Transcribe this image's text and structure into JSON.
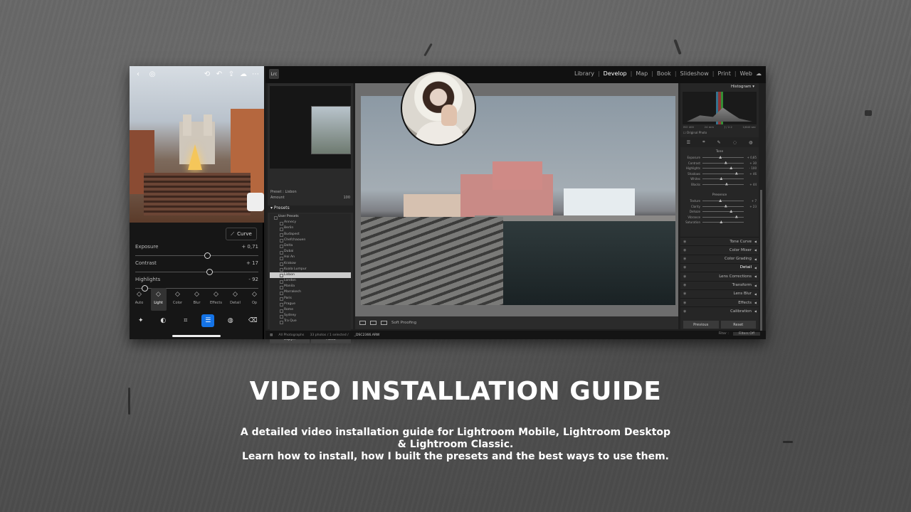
{
  "headline": {
    "title": "VIDEO INSTALLATION GUIDE",
    "line1": "A detailed video installation guide for Lightroom Mobile, Lightroom Desktop",
    "line2": "& Lightroom Classic.",
    "line3": "Learn how to install, how I built the presets and the best ways to use them."
  },
  "mobile": {
    "curve_label": "Curve",
    "sliders": [
      {
        "label": "Exposure",
        "value": "+ 0,71",
        "level": 0.56
      },
      {
        "label": "Contrast",
        "value": "+ 17",
        "level": 0.58
      },
      {
        "label": "Highlights",
        "value": "- 92",
        "level": 0.05
      }
    ],
    "tools": [
      {
        "label": "Auto",
        "icon": "auto-icon"
      },
      {
        "label": "Light",
        "icon": "sun-icon",
        "active": true
      },
      {
        "label": "Color",
        "icon": "thermometer-icon"
      },
      {
        "label": "Blur",
        "icon": "drop-icon"
      },
      {
        "label": "Effects",
        "icon": "effects-icon"
      },
      {
        "label": "Detail",
        "icon": "triangle-icon"
      },
      {
        "label": "Op",
        "icon": "optics-icon"
      }
    ],
    "accent": "#1473e6"
  },
  "classic": {
    "modules": [
      "Library",
      "Develop",
      "Map",
      "Book",
      "Slideshow",
      "Print",
      "Web"
    ],
    "active_module": "Develop",
    "preset_line": "Preset : Lisbon",
    "amount_label": "Amount",
    "amount_value": "100",
    "presets_header": "Presets",
    "preset_group": "User Presets",
    "presets": [
      "Annecy",
      "Berlin",
      "Budapest",
      "Chefchaouen",
      "Delta",
      "Dubai",
      "Hoi An",
      "Krakow",
      "Kuala Lumpur",
      "Lisbon",
      "London",
      "Manila",
      "Marrakech",
      "Paris",
      "Prague",
      "Rome",
      "Sydney",
      "Tra Que"
    ],
    "selected_preset": "Lisbon",
    "copy_label": "Copy...",
    "paste_label": "Paste",
    "soft_proofing": "Soft Proofing",
    "histogram_label": "Histogram",
    "original_photo": "Original Photo",
    "tone_title": "Tone",
    "tone_sliders": [
      {
        "label": "Exposure",
        "value": "+ 0,85"
      },
      {
        "label": "Contrast",
        "value": "+ 30"
      },
      {
        "label": "Highlights",
        "value": "- 100"
      },
      {
        "label": "Shadows",
        "value": "+ 46"
      },
      {
        "label": "Whites",
        "value": ""
      },
      {
        "label": "Blacks",
        "value": "+ 44"
      }
    ],
    "presence_title": "Presence",
    "presence_sliders": [
      {
        "label": "Texture",
        "value": "+ 7"
      },
      {
        "label": "Clarity",
        "value": "+ 23"
      },
      {
        "label": "Dehaze",
        "value": ""
      },
      {
        "label": "Vibrance",
        "value": ""
      },
      {
        "label": "Saturation",
        "value": ""
      }
    ],
    "panels": [
      "Tone Curve",
      "Color Mixer",
      "Color Grading",
      "Detail",
      "Lens Corrections",
      "Transform",
      "Lens Blur",
      "Effects",
      "Calibration"
    ],
    "previous_label": "Previous",
    "reset_label": "Reset",
    "bottom_status": "All Photographs",
    "bottom_count": "33 photos / 1 selected /",
    "bottom_file": "_DSC2366.ARW",
    "filter_label": "Filter :",
    "filter_value": "Filters Off"
  }
}
